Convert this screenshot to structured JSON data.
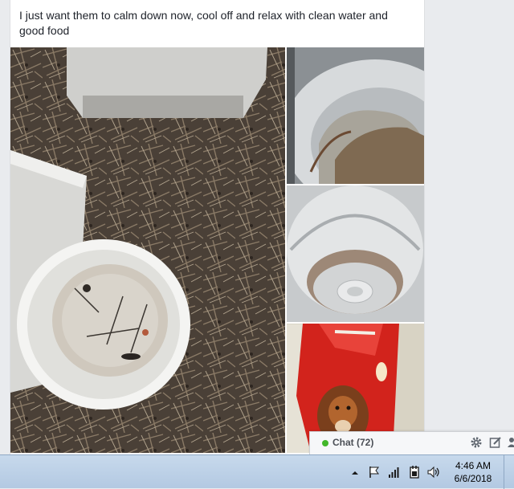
{
  "post": {
    "text": "I just want them to calm down now, cool off and relax with clean water and good food",
    "photos": [
      {
        "name": "photo-white-dog-bowl",
        "alt": "white bowl with dirty water on pine straw"
      },
      {
        "name": "photo-metal-bowl-water",
        "alt": "metal bowl with brown water"
      },
      {
        "name": "photo-metal-bowl-empty",
        "alt": "empty metal bowl"
      },
      {
        "name": "photo-dog-food-bag",
        "alt": "red dog food bag"
      }
    ]
  },
  "chat": {
    "label": "Chat (72)",
    "status_color": "#42b72a",
    "icons": [
      "gear-icon",
      "compose-icon",
      "add-people-icon"
    ]
  },
  "taskbar": {
    "time": "4:46 AM",
    "date": "6/6/2018",
    "tray_icons": [
      "show-hidden-icons-arrow",
      "flag-icon",
      "network-signal-icon",
      "power-icon",
      "volume-icon"
    ]
  }
}
